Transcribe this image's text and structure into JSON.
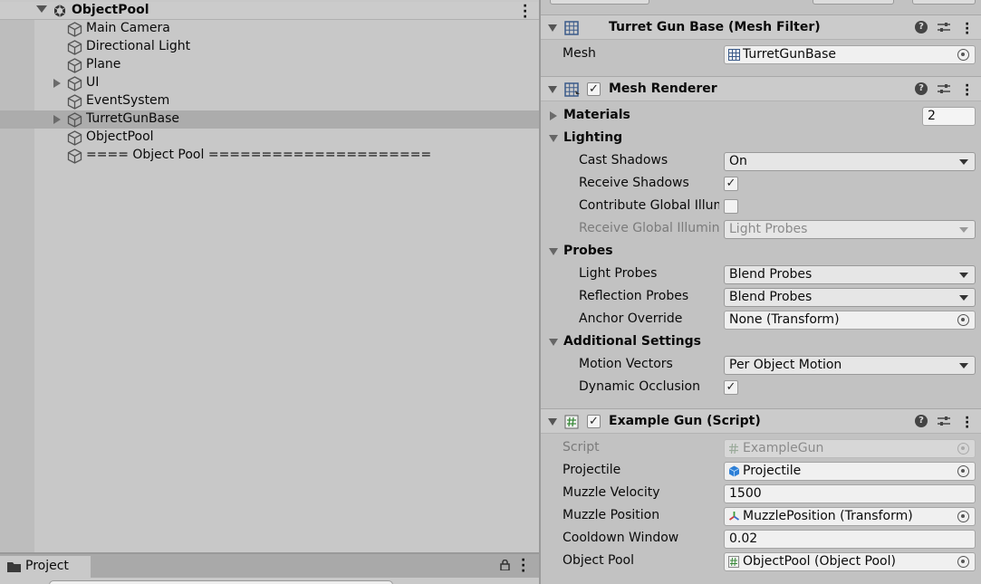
{
  "hierarchy": {
    "scene_title": "ObjectPool",
    "items": [
      {
        "label": "Main Camera",
        "expandable": false,
        "selected": false
      },
      {
        "label": "Directional Light",
        "expandable": false,
        "selected": false
      },
      {
        "label": "Plane",
        "expandable": false,
        "selected": false
      },
      {
        "label": "UI",
        "expandable": true,
        "selected": false
      },
      {
        "label": "EventSystem",
        "expandable": false,
        "selected": false
      },
      {
        "label": "TurretGunBase",
        "expandable": true,
        "selected": true
      },
      {
        "label": "ObjectPool",
        "expandable": false,
        "selected": false
      },
      {
        "label": "==== Object Pool =====================",
        "expandable": false,
        "selected": false
      }
    ]
  },
  "project": {
    "tab_label": "Project"
  },
  "inspector": {
    "mesh_filter": {
      "title": "Turret Gun Base (Mesh Filter)",
      "mesh_label": "Mesh",
      "mesh_value": "TurretGunBase"
    },
    "mesh_renderer": {
      "title": "Mesh Renderer",
      "enabled": true,
      "materials_label": "Materials",
      "materials_count": "2",
      "lighting_label": "Lighting",
      "cast_shadows_label": "Cast Shadows",
      "cast_shadows_value": "On",
      "receive_shadows_label": "Receive Shadows",
      "receive_shadows_checked": true,
      "contribute_gi_label": "Contribute Global Illumination",
      "contribute_gi_checked": false,
      "receive_gi_label": "Receive Global Illumination",
      "receive_gi_value": "Light Probes",
      "probes_label": "Probes",
      "light_probes_label": "Light Probes",
      "light_probes_value": "Blend Probes",
      "reflection_probes_label": "Reflection Probes",
      "reflection_probes_value": "Blend Probes",
      "anchor_override_label": "Anchor Override",
      "anchor_override_value": "None (Transform)",
      "additional_label": "Additional Settings",
      "motion_vectors_label": "Motion Vectors",
      "motion_vectors_value": "Per Object Motion",
      "dynamic_occlusion_label": "Dynamic Occlusion",
      "dynamic_occlusion_checked": true
    },
    "example_gun": {
      "title": "Example Gun (Script)",
      "enabled": true,
      "script_label": "Script",
      "script_value": "ExampleGun",
      "projectile_label": "Projectile",
      "projectile_value": "Projectile",
      "muzzle_velocity_label": "Muzzle Velocity",
      "muzzle_velocity_value": "1500",
      "muzzle_position_label": "Muzzle Position",
      "muzzle_position_value": "MuzzlePosition (Transform)",
      "cooldown_label": "Cooldown Window",
      "cooldown_value": "0.02",
      "object_pool_label": "Object Pool",
      "object_pool_value": "ObjectPool (Object Pool)"
    }
  }
}
